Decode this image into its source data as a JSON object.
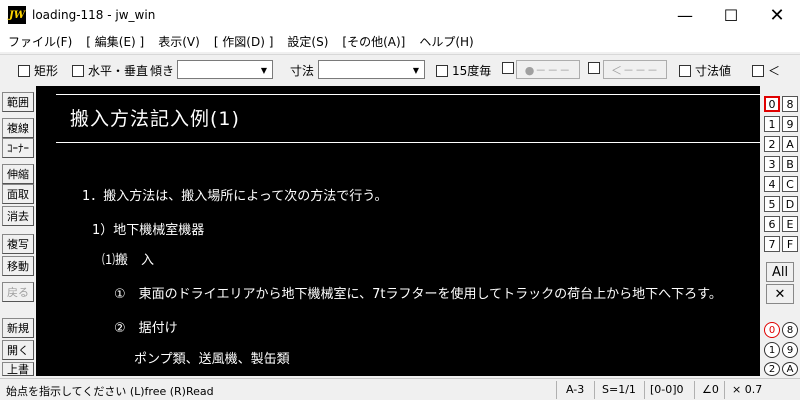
{
  "titlebar": {
    "logo": "JW",
    "title": "loading-118 - jw_win",
    "minimize": "—",
    "maximize": "☐",
    "close": "✕"
  },
  "menu": [
    "ファイル(F)",
    "[ 編集(E) ]",
    "表示(V)",
    "[ 作図(D) ]",
    "設定(S)",
    "[その他(A)]",
    "ヘルプ(H)"
  ],
  "toolbar": {
    "rect_label": "矩形",
    "hv_label": "水平・垂直",
    "tilt_label": "傾き",
    "tilt_value": "",
    "dimension_label": "寸法",
    "dimension_value": "",
    "deg15_label": "15度毎",
    "line_btn1": "●－－－",
    "line_btn2": "＜－－－",
    "dimvalue_label": "寸法値",
    "lt_label": "＜"
  },
  "left_tools": [
    "範囲",
    "複線",
    "ｺｰﾅｰ",
    "伸縮",
    "面取",
    "消去",
    "複写",
    "移動",
    "戻る",
    "新規",
    "開く",
    "上書"
  ],
  "canvas": {
    "title": "搬入方法記入例(1)",
    "lines": [
      "1．搬入方法は、搬入場所によって次の方法で行う。",
      "1）地下機械室機器",
      "⑴搬　入",
      "①　東面のドライエリアから地下機械室に、7tラフターを使用してトラックの荷台上から地下へ下ろす。",
      "②　据付け",
      "ポンプ類、送風機、製缶類"
    ]
  },
  "layers": {
    "col1": [
      "0",
      "1",
      "2",
      "3",
      "4",
      "5",
      "6",
      "7"
    ],
    "col2": [
      "8",
      "9",
      "A",
      "B",
      "C",
      "D",
      "E",
      "F"
    ],
    "all": "All",
    "cross": "✕",
    "groups_col1": [
      "0",
      "1",
      "2"
    ],
    "groups_col2": [
      "8",
      "9",
      "A"
    ]
  },
  "status": {
    "message": "始点を指示してください (L)free (R)Read",
    "paper": "A-3",
    "scale": "S=1/1",
    "layer": "[0-0]0",
    "angle": "∠0",
    "zoom": "× 0.7"
  }
}
